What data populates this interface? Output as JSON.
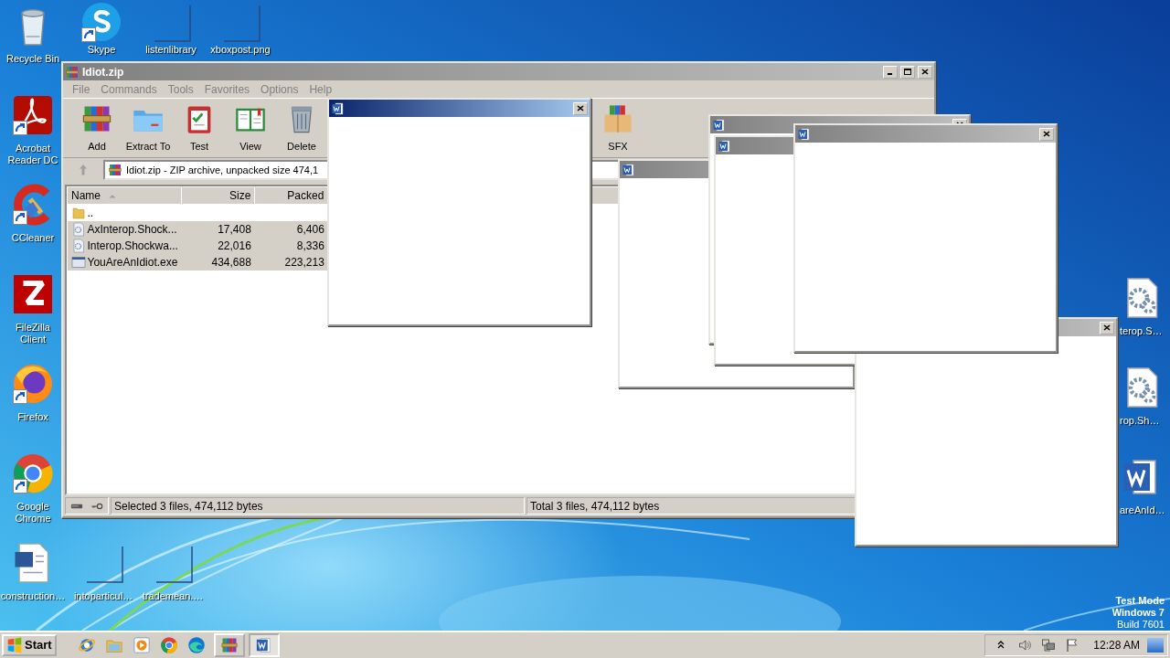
{
  "desktop": {
    "wallpaper": {
      "kind": "picture"
    },
    "left_column": [
      {
        "label": "Recycle Bin",
        "kind": "recycle",
        "shortcut": false
      },
      {
        "label": "Acrobat Reader DC",
        "kind": "acrobat",
        "shortcut": true
      },
      {
        "label": "CCleaner",
        "kind": "ccleaner",
        "shortcut": true
      },
      {
        "label": "FileZilla Client",
        "kind": "filezilla",
        "shortcut": false
      },
      {
        "label": "Firefox",
        "kind": "firefox",
        "shortcut": true
      },
      {
        "label": "Google Chrome",
        "kind": "chrome",
        "shortcut": true
      },
      {
        "label": "construction…",
        "kind": "worddoc",
        "shortcut": false
      }
    ],
    "top_row": [
      {
        "label": "Skype",
        "kind": "skype",
        "shortcut": true
      },
      {
        "label": "listenlibrary",
        "kind": "blank",
        "shortcut": false
      },
      {
        "label": "xboxpost.png",
        "kind": "blank",
        "shortcut": false
      }
    ],
    "bottom_row": [
      {
        "label": "intoparticul…",
        "kind": "blank",
        "shortcut": false
      },
      {
        "label": "trademean.…",
        "kind": "blank",
        "shortcut": false
      }
    ],
    "right_column": [
      {
        "label": "terop.S…",
        "kind": "geardoc",
        "shortcut": false
      },
      {
        "label": "rop.Sh…",
        "kind": "geardoc",
        "shortcut": false
      },
      {
        "label": "areAnId…",
        "kind": "word",
        "shortcut": false
      }
    ],
    "os_notice": [
      "Test Mode",
      "Windows 7",
      "Build 7601"
    ]
  },
  "archive_window": {
    "title": "Idiot.zip",
    "active": false,
    "menu": [
      {
        "label": "File",
        "disabled": true
      },
      {
        "label": "Commands",
        "disabled": true
      },
      {
        "label": "Tools",
        "disabled": true
      },
      {
        "label": "Favorites",
        "disabled": true
      },
      {
        "label": "Options",
        "disabled": true
      },
      {
        "label": "Help",
        "disabled": true
      }
    ],
    "toolbar": [
      {
        "label": "Add",
        "kind": "add"
      },
      {
        "label": "Extract To",
        "kind": "extract"
      },
      {
        "label": "Test",
        "kind": "test"
      },
      {
        "label": "View",
        "kind": "view"
      },
      {
        "label": "Delete",
        "kind": "delete"
      },
      {
        "label": "SFX",
        "kind": "sfx"
      }
    ],
    "address": "Idiot.zip - ZIP archive, unpacked size 474,1",
    "columns": [
      {
        "label": "Name",
        "sorted": true
      },
      {
        "label": "Size",
        "sorted": false
      },
      {
        "label": "Packed",
        "sorted": false
      }
    ],
    "rows": [
      {
        "name": "..",
        "kind": "folder",
        "selected": false
      },
      {
        "name": "AxInterop.Shock...",
        "kind": "dll",
        "size": "17,408",
        "packed": "6,406",
        "selected": true
      },
      {
        "name": "Interop.Shockwa...",
        "kind": "dll",
        "size": "22,016",
        "packed": "8,336",
        "selected": true
      },
      {
        "name": "YouAreAnIdiot.exe",
        "kind": "exe",
        "size": "434,688",
        "packed": "223,213",
        "selected": true
      }
    ],
    "status": [
      "Selected 3 files, 474,112 bytes",
      "Total 3 files, 474,112 bytes"
    ]
  },
  "popups": [
    {
      "active": true,
      "close_button": true,
      "title_icon": true
    },
    {
      "active": false,
      "close_button": false,
      "title_icon": true
    },
    {
      "active": false,
      "close_button": true,
      "title_icon": true
    },
    {
      "active": false,
      "close_button": false,
      "title_icon": true
    },
    {
      "active": false,
      "close_button": true,
      "title_icon": false
    },
    {
      "active": false,
      "close_button": true,
      "title_icon": true
    }
  ],
  "taskbar": {
    "start": "Start",
    "quick_launch": [
      {
        "kind": "ie"
      },
      {
        "kind": "explorer"
      },
      {
        "kind": "media"
      },
      {
        "kind": "chrome"
      },
      {
        "kind": "edge"
      }
    ],
    "windows": [
      {
        "kind": "winrar",
        "pressed": false
      },
      {
        "kind": "word",
        "pressed": true
      }
    ],
    "tray": [
      {
        "kind": "chevron"
      },
      {
        "kind": "speaker"
      },
      {
        "kind": "network"
      },
      {
        "kind": "flag"
      }
    ],
    "clock": "12:28 AM"
  }
}
